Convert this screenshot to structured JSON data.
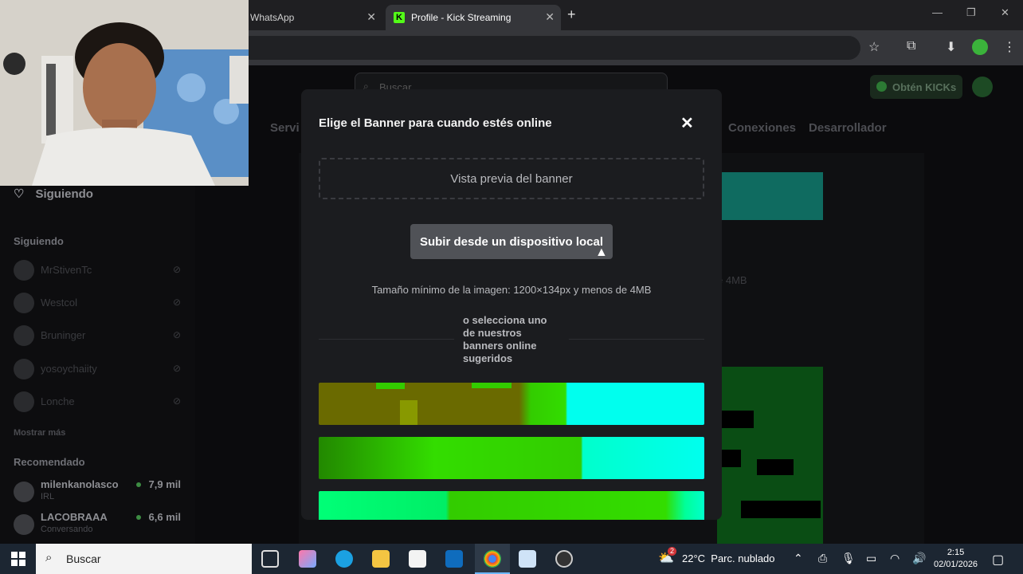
{
  "browser": {
    "tabs": [
      {
        "title": "WhatsApp",
        "active": false
      },
      {
        "title": "Profile - Kick Streaming",
        "active": true
      }
    ],
    "new_tab_icon": "plus-icon"
  },
  "page": {
    "search_placeholder": "Buscar",
    "kicks_button": "Obtén KICKs",
    "nav_tabs": [
      "Servi",
      "Conexiones",
      "Desarrollador"
    ],
    "bg_note": "e 4MB"
  },
  "sidebar": {
    "following_title": "Siguiendo",
    "following_header": "Siguiendo",
    "following_channels": [
      "MrStivenTc",
      "Westcol",
      "Bruninger",
      "yosoychaiity",
      "Lonche"
    ],
    "show_more": "Mostrar más",
    "recommended_header": "Recomendado",
    "recommended": [
      {
        "name": "milenkanolasco",
        "category": "IRL",
        "viewers": "7,9 mil"
      },
      {
        "name": "LACOBRAAA",
        "category": "Conversando",
        "viewers": "6,6 mil"
      }
    ]
  },
  "modal": {
    "title": "Elige el Banner para cuando estés online",
    "preview_label": "Vista previa del banner",
    "upload_button": "Subir desde un dispositivo local",
    "size_note": "Tamaño mínimo de la imagen: 1200×134px y menos de 4MB",
    "or_select_text": "o selecciona uno de nuestros banners online sugeridos",
    "banner_colors": [
      "#6a6a00",
      "#33cc00",
      "#00ff66"
    ]
  },
  "taskbar": {
    "search_placeholder": "Buscar",
    "weather_temp": "22°C",
    "weather_desc": "Parc. nublado",
    "weather_badge": "2",
    "time": "2:15",
    "date": "02/01/2026"
  }
}
